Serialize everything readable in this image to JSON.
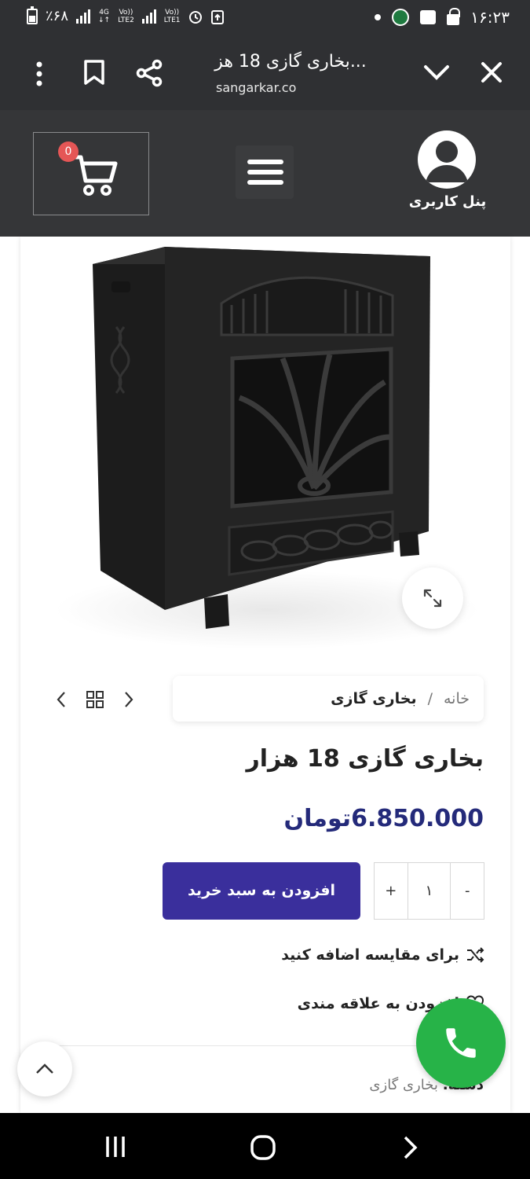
{
  "status_bar": {
    "battery_text": "٪۶۸",
    "network_1": "4G",
    "network_1_sub": "LTE2",
    "network_2_top": "Vo))",
    "network_2_sub": "LTE1",
    "time": "۱۶:۲۳"
  },
  "browser": {
    "page_title": "بخاری گازی 18 هز...",
    "domain": "sangarkar.co"
  },
  "header": {
    "cart_count": "0",
    "user_panel_label": "پنل کاربری"
  },
  "breadcrumb": {
    "home": "خانه",
    "separator": "/",
    "current": "بخاری گازی"
  },
  "product": {
    "title": "بخاری گازی 18 هزار",
    "price": "6.850.000تومان",
    "quantity": "۱",
    "qty_plus": "+",
    "qty_minus": "-",
    "add_to_cart_label": "افزودن به سبد خرید",
    "compare_label": "برای مقایسه اضافه کنید",
    "wishlist_label": "افزودن به علاقه مندی",
    "category_label": "دسته:",
    "category_value": "بخاری گازی"
  },
  "colors": {
    "dark_bar": "#2f3033",
    "header_bg": "#353638",
    "accent_purple": "#3a2f9c",
    "price_blue": "#242a7a",
    "call_green": "#27b348",
    "badge_red": "#e55656"
  }
}
